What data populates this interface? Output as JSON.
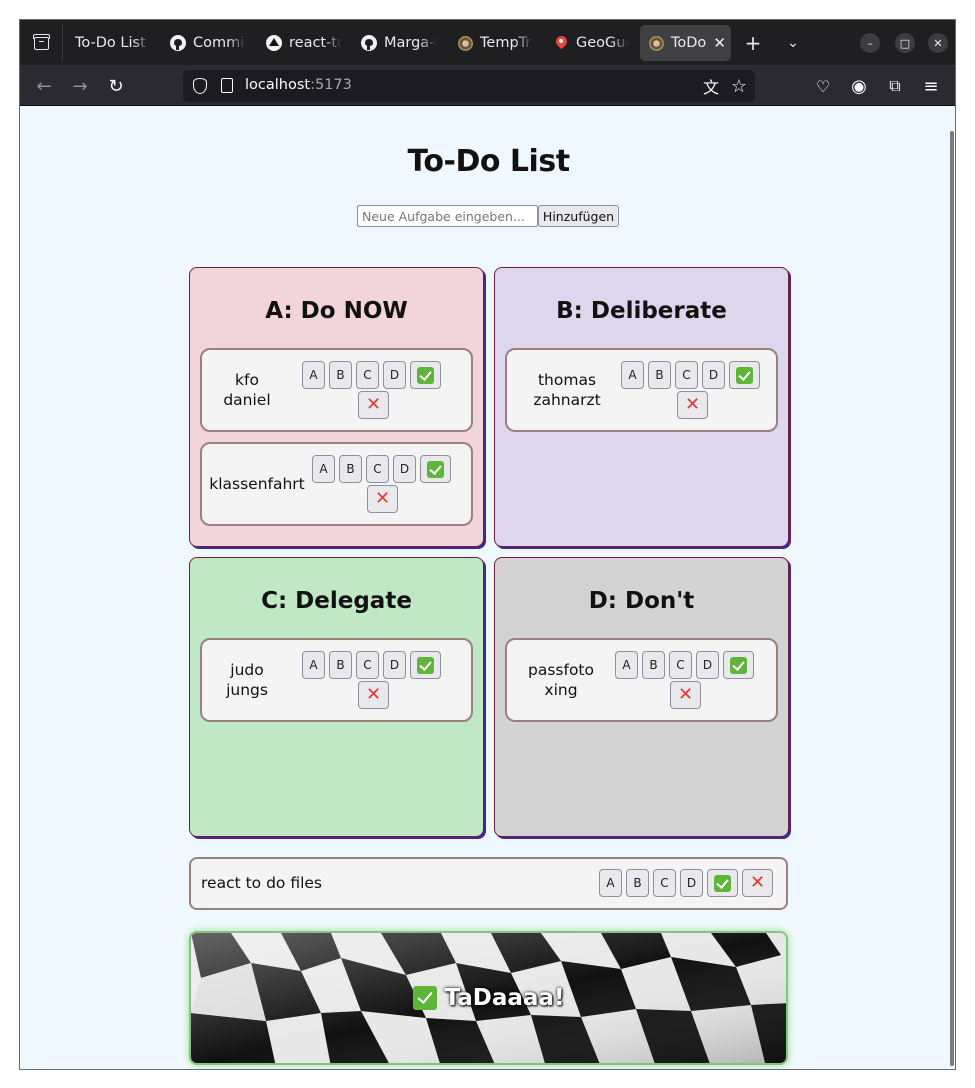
{
  "browser": {
    "tabs": [
      {
        "label": "To-Do List v",
        "icon": "none"
      },
      {
        "label": "Commit",
        "icon": "github-icon"
      },
      {
        "label": "react-to",
        "icon": "triangle-icon"
      },
      {
        "label": "Marga-L",
        "icon": "github-icon"
      },
      {
        "label": "TempTr",
        "icon": "app-icon"
      },
      {
        "label": "GeoGue",
        "icon": "map-pin-icon"
      },
      {
        "label": "ToDo",
        "icon": "app-icon",
        "active": true
      }
    ],
    "url_host": "localhost",
    "url_port": ":5173"
  },
  "app": {
    "title": "To-Do List",
    "new_task_placeholder": "Neue Aufgabe eingeben...",
    "add_button": "Hinzufügen",
    "move_labels": [
      "A",
      "B",
      "C",
      "D"
    ],
    "quadrants": [
      {
        "title": "A: Do NOW",
        "color": "#f2d5db",
        "tasks": [
          "kfo daniel",
          "klassenfahrt"
        ]
      },
      {
        "title": "B: Deliberate",
        "color": "#ded6ec",
        "tasks": [
          "thomas zahnarzt"
        ]
      },
      {
        "title": "C: Delegate",
        "color": "#c1e8c5",
        "tasks": [
          "judo jungs"
        ]
      },
      {
        "title": "D: Don't",
        "color": "#d3d3d3",
        "tasks": [
          "passfoto xing"
        ]
      }
    ],
    "unsorted_tasks": [
      "react to do files"
    ],
    "done_banner": "TaDaaaa!"
  }
}
